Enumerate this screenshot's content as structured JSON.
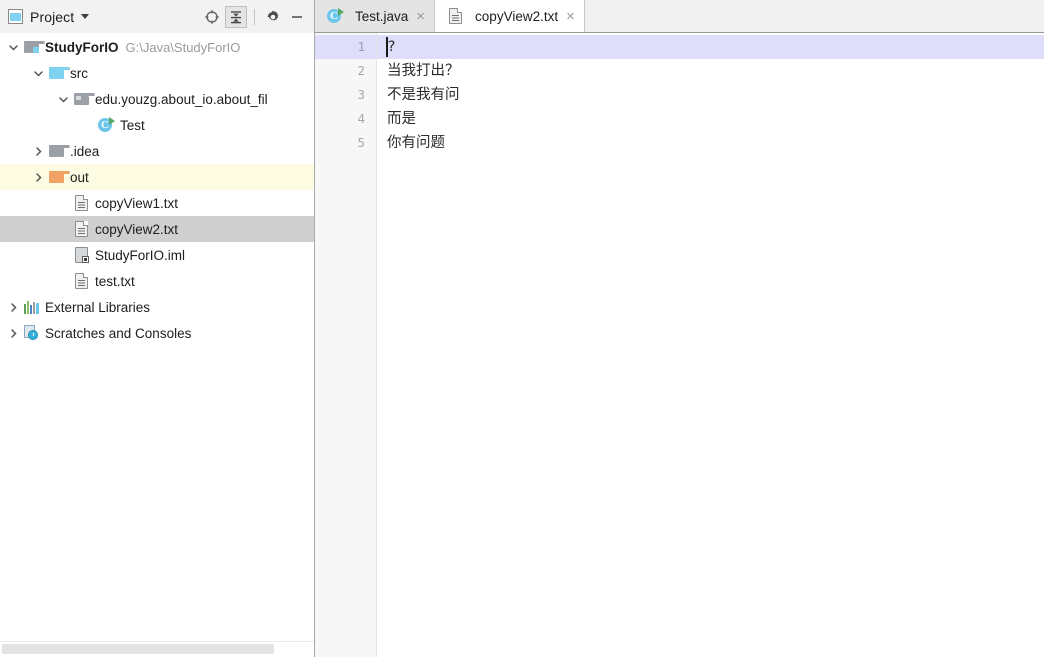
{
  "tool_window": {
    "title": "Project",
    "icons": {
      "project": "project-icon",
      "dropdown": "chevron-down-icon",
      "locate": "locate-target-icon",
      "collapse_all": "collapse-all-icon",
      "settings": "gear-icon",
      "hide": "minimize-icon"
    },
    "tree": [
      {
        "label": "StudyForIO",
        "secondary": "G:\\Java\\StudyForIO",
        "icon": "module-folder-icon",
        "indent": 0,
        "arrow": "expanded",
        "bold": true,
        "state": "normal"
      },
      {
        "label": "src",
        "secondary": "",
        "icon": "source-folder-icon",
        "indent": 1,
        "arrow": "expanded",
        "bold": false,
        "state": "normal"
      },
      {
        "label": "edu.youzg.about_io.about_fil",
        "secondary": "",
        "icon": "package-icon",
        "indent": 2,
        "arrow": "expanded",
        "bold": false,
        "state": "normal"
      },
      {
        "label": "Test",
        "secondary": "",
        "icon": "java-class-runnable-icon",
        "indent": 3,
        "arrow": "none",
        "bold": false,
        "state": "normal"
      },
      {
        "label": ".idea",
        "secondary": "",
        "icon": "gray-folder-icon",
        "indent": 1,
        "arrow": "collapsed",
        "bold": false,
        "state": "normal"
      },
      {
        "label": "out",
        "secondary": "",
        "icon": "excluded-folder-icon",
        "indent": 1,
        "arrow": "collapsed",
        "bold": false,
        "state": "excluded"
      },
      {
        "label": "copyView1.txt",
        "secondary": "",
        "icon": "text-file-icon",
        "indent": 2,
        "arrow": "none",
        "bold": false,
        "state": "normal"
      },
      {
        "label": "copyView2.txt",
        "secondary": "",
        "icon": "text-file-icon",
        "indent": 2,
        "arrow": "none",
        "bold": false,
        "state": "selected"
      },
      {
        "label": "StudyForIO.iml",
        "secondary": "",
        "icon": "iml-file-icon",
        "indent": 2,
        "arrow": "none",
        "bold": false,
        "state": "normal"
      },
      {
        "label": "test.txt",
        "secondary": "",
        "icon": "text-file-icon",
        "indent": 2,
        "arrow": "none",
        "bold": false,
        "state": "normal"
      },
      {
        "label": "External Libraries",
        "secondary": "",
        "icon": "external-libraries-icon",
        "indent": 0,
        "arrow": "collapsed",
        "bold": false,
        "state": "normal"
      },
      {
        "label": "Scratches and Consoles",
        "secondary": "",
        "icon": "scratches-icon",
        "indent": 0,
        "arrow": "collapsed",
        "bold": false,
        "state": "normal"
      }
    ]
  },
  "editor": {
    "tabs": [
      {
        "label": "Test.java",
        "icon": "java-class-runnable-icon",
        "active": false,
        "close": "×"
      },
      {
        "label": "copyView2.txt",
        "icon": "text-file-icon",
        "active": true,
        "close": "×"
      }
    ],
    "lines": [
      {
        "number": "1",
        "text": "?",
        "current": true
      },
      {
        "number": "2",
        "text": "当我打出？",
        "current": false
      },
      {
        "number": "3",
        "text": "不是我有问",
        "current": false
      },
      {
        "number": "4",
        "text": "而是",
        "current": false
      },
      {
        "number": "5",
        "text": "你有问题",
        "current": false
      }
    ]
  },
  "colors": {
    "current_line": "#dedefa",
    "selection": "#cfcfcf",
    "excluded": "#fdfbe2",
    "toolbar": "#f2f2f2",
    "gutter": "#f7f7f7"
  }
}
